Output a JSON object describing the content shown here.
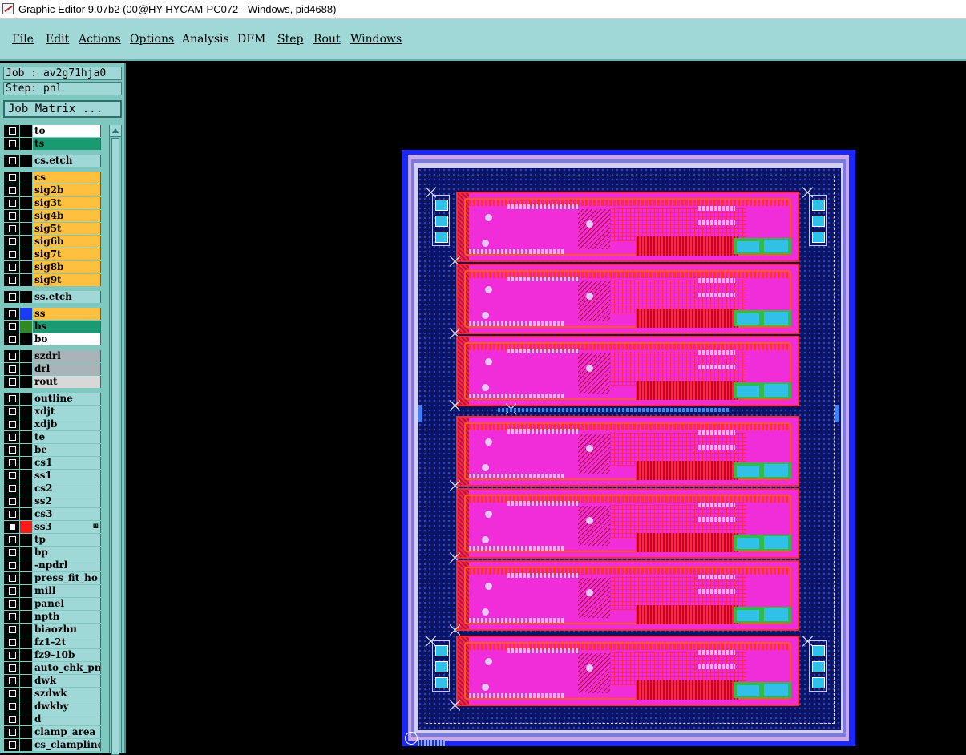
{
  "window": {
    "title": "Graphic Editor 9.07b2 (00@HY-HYCAM-PC072 - Windows, pid4688)"
  },
  "menu": [
    {
      "label": "File"
    },
    {
      "label": "Edit"
    },
    {
      "label": "Actions"
    },
    {
      "label": "Options"
    },
    {
      "label": "Analysis"
    },
    {
      "label": "DFM"
    },
    {
      "label": "Step"
    },
    {
      "label": "Rout"
    },
    {
      "label": "Windows"
    }
  ],
  "sidebar": {
    "job_line": "Job : av2g71hja0",
    "step_line": "Step: pnl",
    "job_matrix_label": "Job Matrix ...",
    "layers": [
      {
        "name": "to",
        "bg": "#ffffff",
        "swatch": "#000000",
        "checked": false
      },
      {
        "name": "ts",
        "bg": "#1a9a70",
        "swatch": "#000000",
        "checked": false
      },
      {
        "name": "cs.etch",
        "bg": "#a0d8d8",
        "swatch": "#000000",
        "checked": false
      },
      {
        "name": "cs",
        "bg": "#ffc040",
        "swatch": "#000000",
        "checked": false
      },
      {
        "name": "sig2b",
        "bg": "#ffc040",
        "swatch": "#000000",
        "checked": false
      },
      {
        "name": "sig3t",
        "bg": "#ffc040",
        "swatch": "#000000",
        "checked": false
      },
      {
        "name": "sig4b",
        "bg": "#ffc040",
        "swatch": "#000000",
        "checked": false
      },
      {
        "name": "sig5t",
        "bg": "#ffc040",
        "swatch": "#000000",
        "checked": false
      },
      {
        "name": "sig6b",
        "bg": "#ffc040",
        "swatch": "#000000",
        "checked": false
      },
      {
        "name": "sig7t",
        "bg": "#ffc040",
        "swatch": "#000000",
        "checked": false
      },
      {
        "name": "sig8b",
        "bg": "#ffc040",
        "swatch": "#000000",
        "checked": false
      },
      {
        "name": "sig9t",
        "bg": "#ffc040",
        "swatch": "#000000",
        "checked": false
      },
      {
        "name": "ss.etch",
        "bg": "#a0d8d8",
        "swatch": "#000000",
        "checked": false
      },
      {
        "name": "ss",
        "bg": "#ffc040",
        "swatch": "#1a3aff",
        "checked": false
      },
      {
        "name": "bs",
        "bg": "#1a9a70",
        "swatch": "#2e8a20",
        "checked": false
      },
      {
        "name": "bo",
        "bg": "#ffffff",
        "swatch": "#000000",
        "checked": false
      },
      {
        "name": "szdrl",
        "bg": "#a8b4b8",
        "swatch": "#000000",
        "checked": false
      },
      {
        "name": "drl",
        "bg": "#a8b4b8",
        "swatch": "#000000",
        "checked": false
      },
      {
        "name": "rout",
        "bg": "#d8d8d8",
        "swatch": "#000000",
        "checked": false
      },
      {
        "name": "outline",
        "bg": "#a0d8d8",
        "swatch": "#000000",
        "checked": false
      },
      {
        "name": "xdjt",
        "bg": "#a0d8d8",
        "swatch": "#000000",
        "checked": false
      },
      {
        "name": "xdjb",
        "bg": "#a0d8d8",
        "swatch": "#000000",
        "checked": false
      },
      {
        "name": "te",
        "bg": "#a0d8d8",
        "swatch": "#000000",
        "checked": false
      },
      {
        "name": "be",
        "bg": "#a0d8d8",
        "swatch": "#000000",
        "checked": false
      },
      {
        "name": "cs1",
        "bg": "#a0d8d8",
        "swatch": "#000000",
        "checked": false
      },
      {
        "name": "ss1",
        "bg": "#a0d8d8",
        "swatch": "#000000",
        "checked": false
      },
      {
        "name": "cs2",
        "bg": "#a0d8d8",
        "swatch": "#000000",
        "checked": false
      },
      {
        "name": "ss2",
        "bg": "#a0d8d8",
        "swatch": "#000000",
        "checked": false
      },
      {
        "name": "cs3",
        "bg": "#a0d8d8",
        "swatch": "#000000",
        "checked": false
      },
      {
        "name": "ss3",
        "bg": "#a0d8d8",
        "swatch": "#ff1a1a",
        "checked": true,
        "mark": "⊞"
      },
      {
        "name": "tp",
        "bg": "#a0d8d8",
        "swatch": "#000000",
        "checked": false
      },
      {
        "name": "bp",
        "bg": "#a0d8d8",
        "swatch": "#000000",
        "checked": false
      },
      {
        "name": "-npdrl",
        "bg": "#a0d8d8",
        "swatch": "#000000",
        "checked": false
      },
      {
        "name": "press_fit_ho",
        "bg": "#a0d8d8",
        "swatch": "#000000",
        "checked": false
      },
      {
        "name": "mill",
        "bg": "#a0d8d8",
        "swatch": "#000000",
        "checked": false
      },
      {
        "name": "panel",
        "bg": "#a0d8d8",
        "swatch": "#000000",
        "checked": false
      },
      {
        "name": "npth",
        "bg": "#a0d8d8",
        "swatch": "#000000",
        "checked": false
      },
      {
        "name": "biaozhu",
        "bg": "#a0d8d8",
        "swatch": "#000000",
        "checked": false
      },
      {
        "name": "fz1-2t",
        "bg": "#a0d8d8",
        "swatch": "#000000",
        "checked": false
      },
      {
        "name": "fz9-10b",
        "bg": "#a0d8d8",
        "swatch": "#000000",
        "checked": false
      },
      {
        "name": "auto_chk_pnl",
        "bg": "#a0d8d8",
        "swatch": "#000000",
        "checked": false
      },
      {
        "name": "dwk",
        "bg": "#a0d8d8",
        "swatch": "#000000",
        "checked": false
      },
      {
        "name": "szdwk",
        "bg": "#a0d8d8",
        "swatch": "#000000",
        "checked": false
      },
      {
        "name": "dwkby",
        "bg": "#a0d8d8",
        "swatch": "#000000",
        "checked": false
      },
      {
        "name": "d",
        "bg": "#a0d8d8",
        "swatch": "#000000",
        "checked": false
      },
      {
        "name": "clamp_area",
        "bg": "#a0d8d8",
        "swatch": "#000000",
        "checked": false
      },
      {
        "name": "cs_clampline",
        "bg": "#a0d8d8",
        "swatch": "#000000",
        "checked": false
      }
    ]
  },
  "canvas": {
    "panel_count": 7
  }
}
